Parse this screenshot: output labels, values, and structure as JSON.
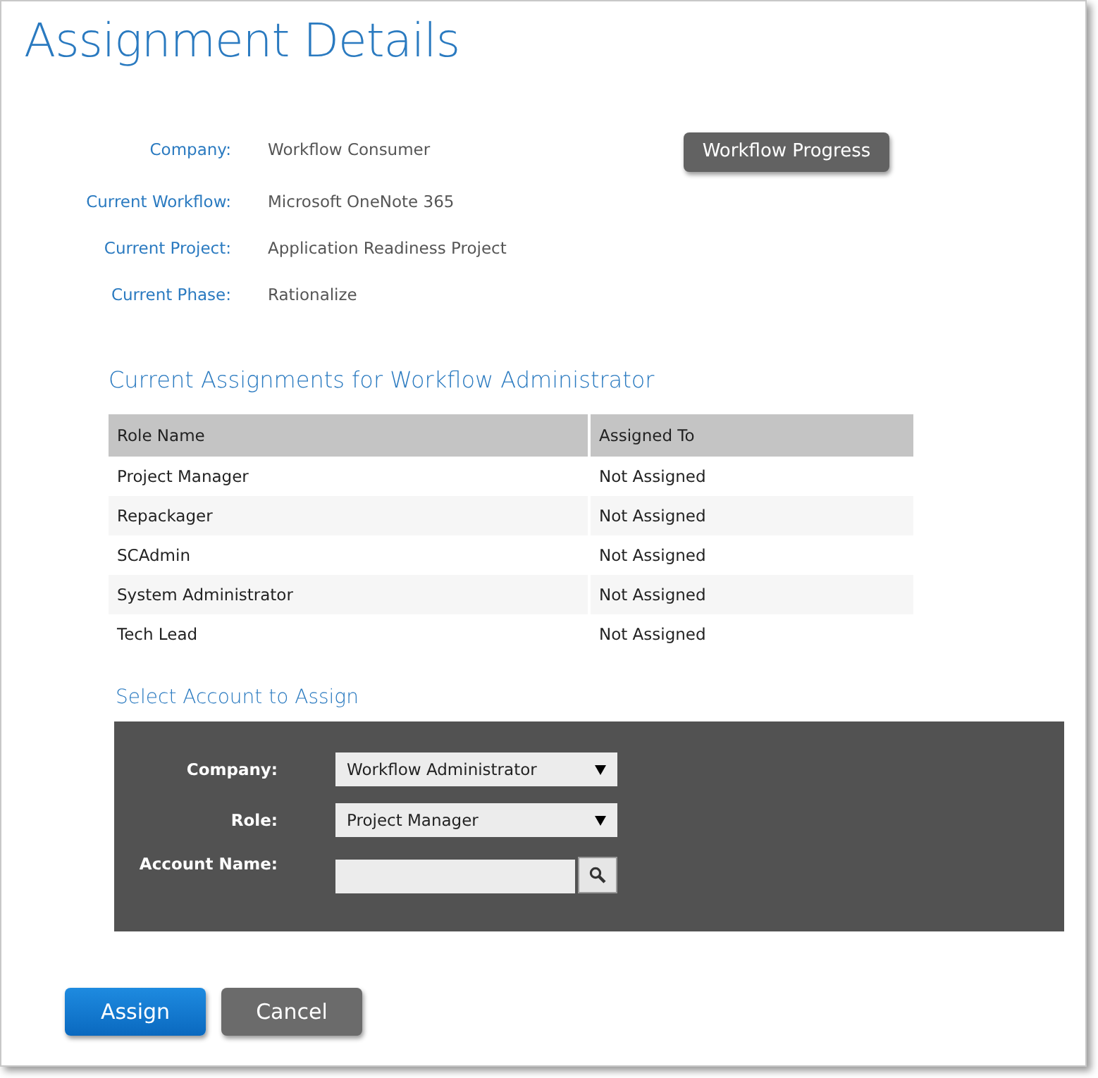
{
  "title": "Assignment Details",
  "details": [
    {
      "label": "Company:",
      "value": "Workflow Consumer"
    },
    {
      "label": "Current Workflow:",
      "value": "Microsoft OneNote 365"
    },
    {
      "label": "Current Project:",
      "value": "Application Readiness Project"
    },
    {
      "label": "Current Phase:",
      "value": "Rationalize"
    }
  ],
  "progress_button": "Workflow Progress",
  "assignments": {
    "heading": "Current Assignments for Workflow Administrator",
    "columns": [
      "Role Name",
      "Assigned To"
    ],
    "rows": [
      [
        "Project Manager",
        "Not Assigned"
      ],
      [
        "Repackager",
        "Not Assigned"
      ],
      [
        "SCAdmin",
        "Not Assigned"
      ],
      [
        "System Administrator",
        "Not Assigned"
      ],
      [
        "Tech Lead",
        "Not Assigned"
      ]
    ]
  },
  "select_account": {
    "heading": "Select Account to Assign",
    "fields": [
      {
        "kind": "dropdown",
        "label": "Company:",
        "value": "Workflow Administrator"
      },
      {
        "kind": "dropdown",
        "label": "Role:",
        "value": "Project Manager"
      },
      {
        "kind": "search",
        "label": "Account Name:"
      }
    ]
  },
  "buttons": [
    {
      "label": "Assign",
      "kind": "primary"
    },
    {
      "label": "Cancel",
      "kind": "secondary"
    }
  ]
}
